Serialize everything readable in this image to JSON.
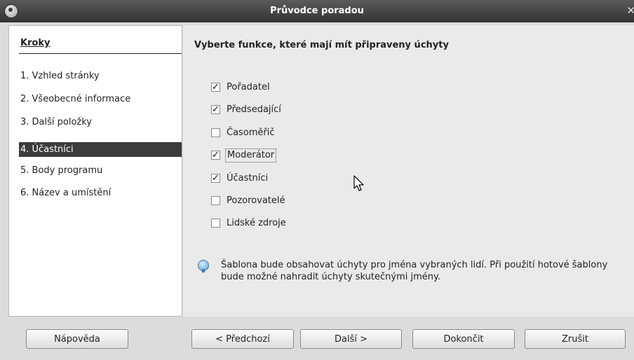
{
  "window": {
    "title": "Průvodce poradou"
  },
  "steps": {
    "title": "Kroky",
    "items": [
      {
        "label": "1. Vzhled stránky",
        "active": false
      },
      {
        "label": "2. Všeobecné informace",
        "active": false
      },
      {
        "label": "3. Další položky",
        "active": false
      },
      {
        "label": "4. Účastníci",
        "active": true
      },
      {
        "label": "5. Body programu",
        "active": false
      },
      {
        "label": "6. Název a umístění",
        "active": false
      }
    ]
  },
  "main": {
    "heading": "Vyberte funkce, které mají mít připraveny úchyty",
    "options": [
      {
        "label": "Pořadatel",
        "checked": true
      },
      {
        "label": "Předsedající",
        "checked": true
      },
      {
        "label": "Časoměřič",
        "checked": false
      },
      {
        "label": "Moderátor",
        "checked": true,
        "focused": true
      },
      {
        "label": "Účastníci",
        "checked": true
      },
      {
        "label": "Pozorovatelé",
        "checked": false
      },
      {
        "label": "Lidské zdroje",
        "checked": false
      }
    ],
    "info_text": "Šablona bude obsahovat úchyty pro jména vybraných lidí. Při použití hotové šablony bude možné nahradit úchyty skutečnými jmény."
  },
  "buttons": {
    "help": "Nápověda",
    "back": "< Předchozí",
    "next": "Další >",
    "finish": "Dokončit",
    "cancel": "Zrušit"
  }
}
